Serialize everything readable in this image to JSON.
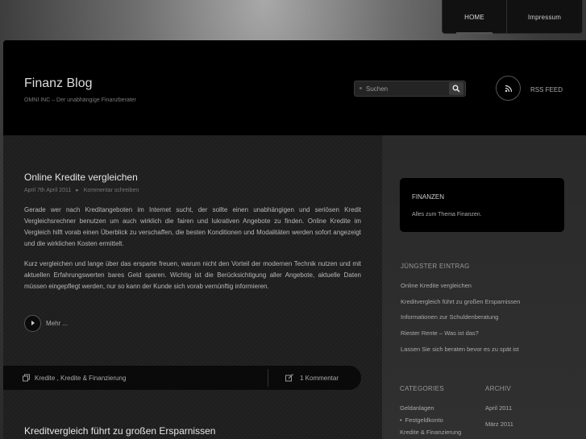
{
  "nav": {
    "items": [
      {
        "label": "HOME"
      },
      {
        "label": "Impressum"
      }
    ]
  },
  "header": {
    "title": "Finanz Blog",
    "tagline": "OMNI INC – Der unabhängige Finanzberater",
    "search_placeholder": "Suchen",
    "rss_label": "RSS FEED"
  },
  "post": {
    "title": "Online Kredite vergleichen",
    "date": "April 7th April 2011",
    "comment_link": "Kommentar schreiben",
    "paragraph1": "Gerade wer nach Kreditangeboten im Internet sucht, der sollte einen unabhängigen und seriösen Kredit Vergleichsrechner benutzen um auch wirklich die fairen und lukrativen Angebote zu finden. Online Kredite im Vergleich hilft vorab einen Überblick zu verschaffen, die besten Konditionen und Modalitäten werden sofort angezeigt und die wirklichen Kosten ermittelt.",
    "paragraph2": "Kurz vergleichen und lange über das ersparte freuen, warum nicht den Vorteil der modernen Technik nutzen und mit aktuellen Erfahrungswerten bares Geld sparen. Wichtig ist die Berücksichtigung aller Angebote, aktuelle Daten müssen eingepflegt werden, nur so kann der Kunde sich vorab vernünftig informieren.",
    "more_label": "Mehr ...",
    "categories": "Kredite , Kredite & Finanzierung",
    "comments": "1 Kommentar"
  },
  "post2": {
    "title": "Kreditvergleich führt zu großen Ersparnissen"
  },
  "sidebar": {
    "box_title": "FINANZEN",
    "box_text": "Alles zum Thema Finanzen.",
    "recent_heading": "JÜNGSTER EINTRAG",
    "recent": [
      "Online Kredite vergleichen",
      "Kreditvergleich führt zu großen Ersparnissen",
      "Informationen zur Schuldenberatung",
      "Riester Rente – Was ist das?",
      "Lassen Sie sich beraten bevor es zu spät ist"
    ],
    "categories_heading": "CATEGORIES",
    "categories": [
      "Geldanlagen",
      "Festgeldkonto",
      "Kredite & Finanzierung"
    ],
    "archive_heading": "ARCHIV",
    "archive": [
      "April 2011",
      "März 2011"
    ]
  },
  "colors": {
    "header_bg": "#000000",
    "content_bg": "#1e1e1e",
    "sidebar_bg": "#2d2d2d",
    "text": "#b9b9b9"
  }
}
